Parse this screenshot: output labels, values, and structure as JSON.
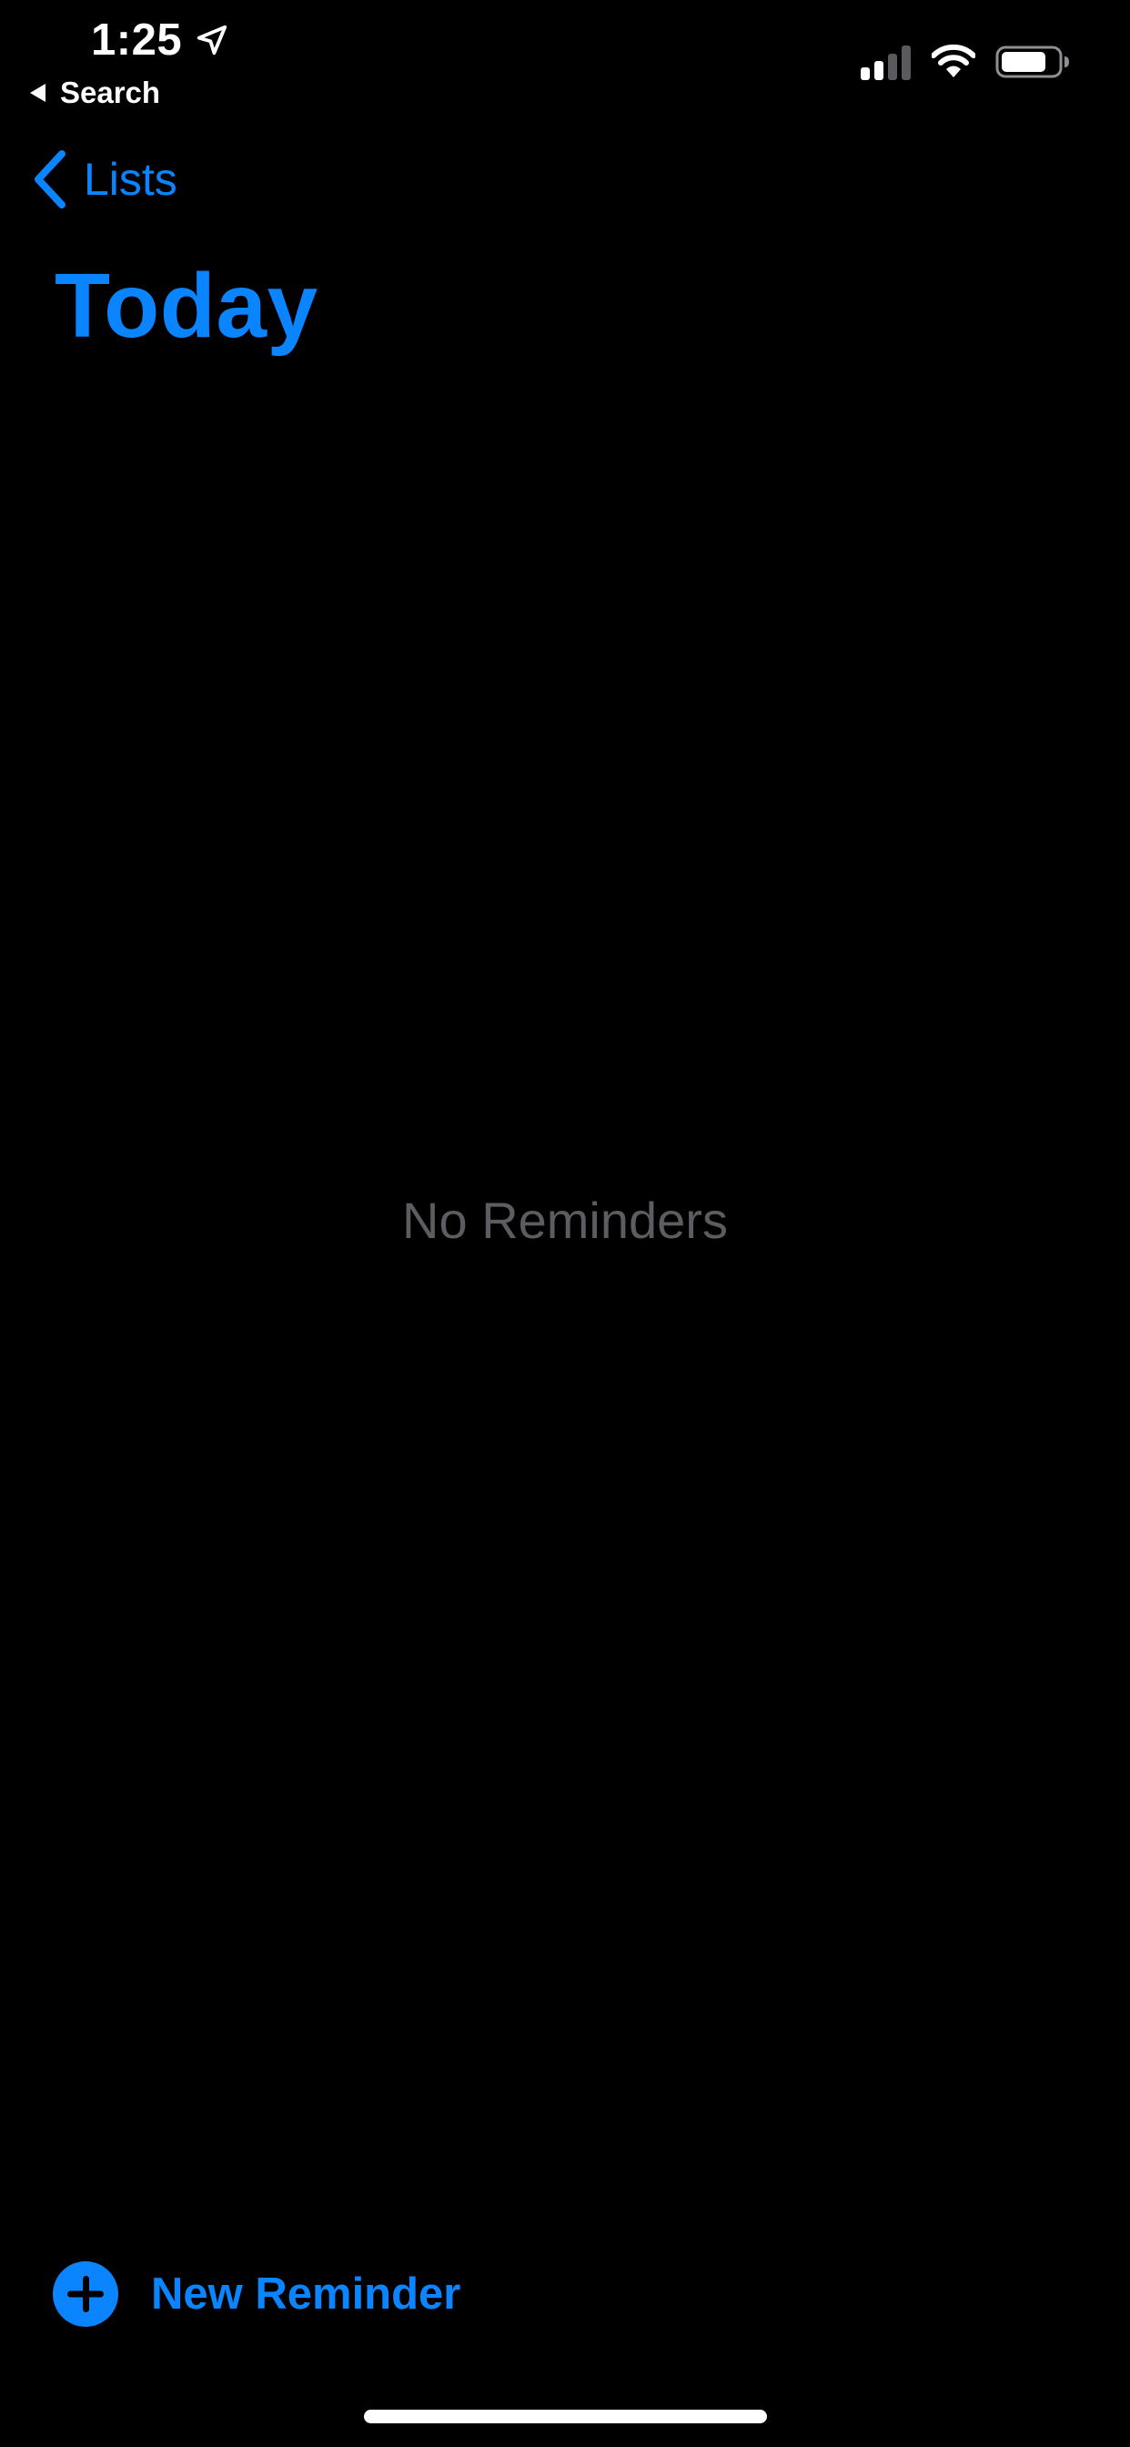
{
  "status_bar": {
    "time": "1:25",
    "back_app_label": "Search",
    "icons": {
      "location": "location-arrow-icon",
      "signal": "cellular-signal-icon",
      "wifi": "wifi-icon",
      "battery": "battery-icon"
    }
  },
  "nav": {
    "back_label": "Lists",
    "back_icon": "chevron-left-icon"
  },
  "page": {
    "title": "Today",
    "empty_message": "No Reminders"
  },
  "toolbar": {
    "new_reminder_label": "New Reminder",
    "new_reminder_icon": "plus-circle-icon"
  },
  "colors": {
    "accent": "#0a84ff",
    "background": "#000000",
    "empty_text": "#5c5c61",
    "status_text": "#ffffff"
  }
}
